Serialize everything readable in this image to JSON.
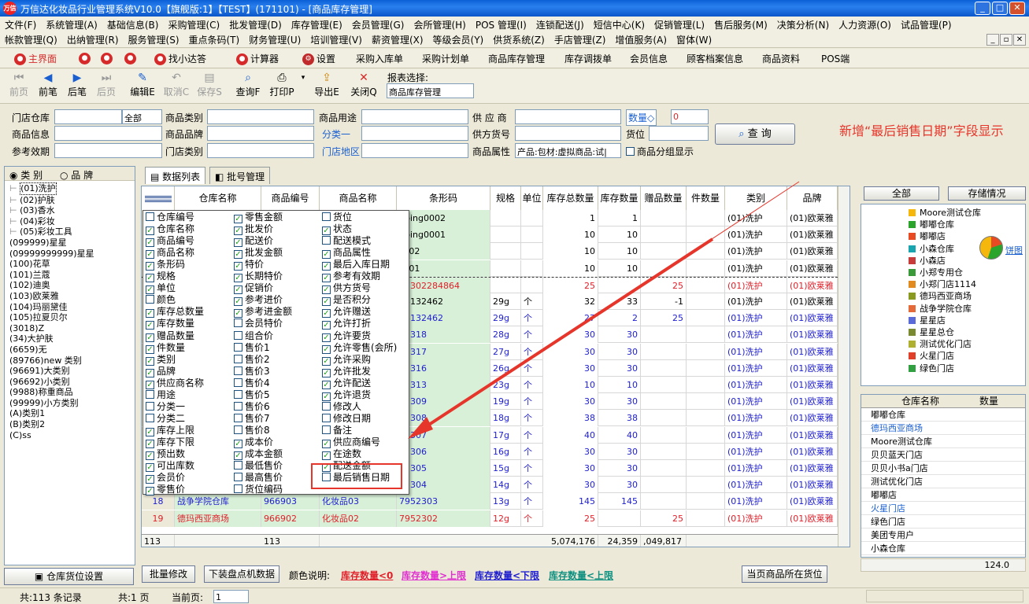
{
  "window": {
    "title": "万信达化妆品行业管理系统V10.0【旗舰版:1】【TEST】(171101) - [商品库存管理]",
    "logo_text": "万信"
  },
  "menu": {
    "row1": [
      "文件(F)",
      "系统管理(A)",
      "基础信息(B)",
      "采购管理(C)",
      "批发管理(D)",
      "库存管理(E)",
      "会员管理(G)",
      "会所管理(H)",
      "POS 管理(I)",
      "连锁配送(J)",
      "短信中心(K)",
      "促销管理(L)",
      "售后服务(M)",
      "决策分析(N)",
      "人力资源(O)",
      "试品管理(P)"
    ],
    "row2": [
      "帐款管理(Q)",
      "出纳管理(R)",
      "服务管理(S)",
      "重点条码(T)",
      "财务管理(U)",
      "培训管理(V)",
      "薪资管理(X)",
      "等级会员(Y)",
      "供货系统(Z)",
      "手店管理(Z)",
      "增值服务(A)",
      "窗体(W)"
    ]
  },
  "quickbar": [
    "主界面",
    "找小达答",
    "计算器",
    "设置",
    "采购入库单",
    "采购计划单",
    "商品库存管理",
    "库存调拨单",
    "会员信息",
    "顾客档案信息",
    "商品资料",
    "POS端"
  ],
  "toolbar": {
    "prev_first": "前页",
    "prev": "前笔",
    "next": "后笔",
    "next_last": "后页",
    "edit": "编辑E",
    "cancel": "取消C",
    "save": "保存S",
    "query": "查询F",
    "print": "打印P",
    "export": "导出E",
    "close": "关闭Q",
    "report_label": "报表选择:",
    "report_value": "商品库存管理"
  },
  "filter": {
    "store_label": "门店仓库",
    "store_all": "全部",
    "category_label": "商品类别",
    "usage_label": "商品用途",
    "supplier_label": "供 应 商",
    "qty_label": "数量◇",
    "qty_value": "0",
    "info_label": "商品信息",
    "brand_label": "商品品牌",
    "class1_label": "分类一",
    "supplier_no_label": "供方货号",
    "location_label": "货位",
    "validity_label": "参考效期",
    "store_cat_label": "门店类别",
    "region_label": "门店地区",
    "attr_label": "商品属性",
    "attr_value": "产品:包材:虚拟商品:试|",
    "group_label": "商品分组显示",
    "query_btn": "查 询"
  },
  "annotation": "新增“最后销售日期”字段显示",
  "left": {
    "radio_cat": "类 别",
    "radio_brand": "品 牌",
    "items": [
      "(01)洗护",
      "(02)护肤",
      "(03)香水",
      "(04)彩妆",
      "(05)彩妆工具",
      "(099999)星星",
      "(09999999999)星星",
      "(100)花草",
      "(101)兰蔻",
      "(102)迪奥",
      "(103)欧莱雅",
      "(104)玛丽黛佳",
      "(105)拉夏贝尔",
      "(3018)Z",
      "(34)大护肤",
      "(6659)无",
      "(89766)new 类别",
      "(96691)大类别",
      "(96692)小类别",
      "(9988)称重商品",
      "(99999)小方类别",
      "(A)类别1",
      "(B)类别2",
      "(C)ss"
    ],
    "bottom_btn": "仓库货位设置"
  },
  "tabs": [
    "数据列表",
    "批号管理"
  ],
  "grid": {
    "headers": [
      "仓库名称",
      "商品编号",
      "商品名称",
      "条形码",
      "规格",
      "单位",
      "库存总数量",
      "库存数量",
      "赠品数量",
      "件数量",
      "类别",
      "品牌"
    ],
    "rows": [
      {
        "n": "",
        "wh": "",
        "code": "",
        "name": "",
        "bar": "nping0002",
        "spec": "",
        "unit": "",
        "tot": "1",
        "qty": "1",
        "gift": "",
        "cat": "(01)洗护",
        "brand": "(01)欧莱雅",
        "color": "black"
      },
      {
        "n": "",
        "wh": "",
        "code": "",
        "name": "",
        "bar": "nping0001",
        "spec": "",
        "unit": "",
        "tot": "10",
        "qty": "10",
        "gift": "",
        "cat": "(01)洗护",
        "brand": "(01)欧莱雅",
        "color": "black"
      },
      {
        "n": "",
        "wh": "",
        "code": "",
        "name": "",
        "bar": "ck02",
        "spec": "",
        "unit": "",
        "tot": "10",
        "qty": "10",
        "gift": "",
        "cat": "(01)洗护",
        "brand": "(01)欧莱雅",
        "color": "black"
      },
      {
        "n": "",
        "wh": "",
        "code": "",
        "name": "",
        "bar": "ck01",
        "spec": "",
        "unit": "",
        "tot": "10",
        "qty": "10",
        "gift": "",
        "cat": "(01)洗护",
        "brand": "(01)欧莱雅",
        "color": "black"
      },
      {
        "n": "",
        "wh": "",
        "code": "",
        "name": "",
        "bar": "97302284864",
        "spec": "",
        "unit": "",
        "tot": "25",
        "qty": "",
        "gift": "25",
        "cat": "(01)洗护",
        "brand": "(01)欧莱雅",
        "color": "red"
      },
      {
        "n": "",
        "wh": "",
        "code": "",
        "name": "",
        "bar": "03132462",
        "spec": "29g",
        "unit": "个",
        "tot": "32",
        "qty": "33",
        "gift": "-1",
        "cat": "(01)洗护",
        "brand": "(01)欧莱雅",
        "color": "black"
      },
      {
        "n": "",
        "wh": "",
        "code": "",
        "name": "",
        "bar": "03132462",
        "spec": "29g",
        "unit": "个",
        "tot": "27",
        "qty": "2",
        "gift": "25",
        "cat": "(01)洗护",
        "brand": "(01)欧莱雅",
        "color": "blue"
      },
      {
        "n": "",
        "wh": "",
        "code": "",
        "name": "",
        "bar": "52318",
        "spec": "28g",
        "unit": "个",
        "tot": "30",
        "qty": "30",
        "gift": "",
        "cat": "(01)洗护",
        "brand": "(01)欧莱雅",
        "color": "blue"
      },
      {
        "n": "",
        "wh": "",
        "code": "",
        "name": "",
        "bar": "52317",
        "spec": "27g",
        "unit": "个",
        "tot": "30",
        "qty": "30",
        "gift": "",
        "cat": "(01)洗护",
        "brand": "(01)欧莱雅",
        "color": "blue"
      },
      {
        "n": "",
        "wh": "",
        "code": "",
        "name": "",
        "bar": "52316",
        "spec": "26g",
        "unit": "个",
        "tot": "30",
        "qty": "30",
        "gift": "",
        "cat": "(01)洗护",
        "brand": "(01)欧莱雅",
        "color": "blue"
      },
      {
        "n": "",
        "wh": "",
        "code": "",
        "name": "",
        "bar": "52313",
        "spec": "23g",
        "unit": "个",
        "tot": "10",
        "qty": "10",
        "gift": "",
        "cat": "(01)洗护",
        "brand": "(01)欧莱雅",
        "color": "blue"
      },
      {
        "n": "",
        "wh": "",
        "code": "",
        "name": "",
        "bar": "52309",
        "spec": "19g",
        "unit": "个",
        "tot": "30",
        "qty": "30",
        "gift": "",
        "cat": "(01)洗护",
        "brand": "(01)欧莱雅",
        "color": "blue"
      },
      {
        "n": "",
        "wh": "",
        "code": "",
        "name": "",
        "bar": "52308",
        "spec": "18g",
        "unit": "个",
        "tot": "38",
        "qty": "38",
        "gift": "",
        "cat": "(01)洗护",
        "brand": "(01)欧莱雅",
        "color": "blue"
      },
      {
        "n": "",
        "wh": "",
        "code": "",
        "name": "",
        "bar": "52307",
        "spec": "17g",
        "unit": "个",
        "tot": "40",
        "qty": "40",
        "gift": "",
        "cat": "(01)洗护",
        "brand": "(01)欧莱雅",
        "color": "blue"
      },
      {
        "n": "",
        "wh": "",
        "code": "",
        "name": "",
        "bar": "52306",
        "spec": "16g",
        "unit": "个",
        "tot": "30",
        "qty": "30",
        "gift": "",
        "cat": "(01)洗护",
        "brand": "(01)欧莱雅",
        "color": "blue"
      },
      {
        "n": "",
        "wh": "",
        "code": "",
        "name": "",
        "bar": "52305",
        "spec": "15g",
        "unit": "个",
        "tot": "30",
        "qty": "30",
        "gift": "",
        "cat": "(01)洗护",
        "brand": "(01)欧莱雅",
        "color": "blue"
      },
      {
        "n": "",
        "wh": "",
        "code": "",
        "name": "",
        "bar": "52304",
        "spec": "14g",
        "unit": "个",
        "tot": "30",
        "qty": "30",
        "gift": "",
        "cat": "(01)洗护",
        "brand": "(01)欧莱雅",
        "color": "blue"
      },
      {
        "n": "18",
        "wh": "战争学院仓库",
        "code": "966903",
        "name": "化妆品03",
        "bar": "7952303",
        "spec": "13g",
        "unit": "个",
        "tot": "145",
        "qty": "145",
        "gift": "",
        "cat": "(01)洗护",
        "brand": "(01)欧莱雅",
        "color": "blue"
      },
      {
        "n": "19",
        "wh": "德玛西亚商场",
        "code": "966902",
        "name": "化妆品02",
        "bar": "7952302",
        "spec": "12g",
        "unit": "个",
        "tot": "25",
        "qty": "",
        "gift": "25",
        "cat": "(01)洗护",
        "brand": "(01)欧莱雅",
        "color": "red"
      }
    ],
    "footer": {
      "count": "113",
      "code_count": "113",
      "tot": "5,074,176",
      "qty": "24,359",
      "gift": ",049,817"
    }
  },
  "popup": {
    "col1": [
      [
        "仓库编号",
        false
      ],
      [
        "仓库名称",
        true
      ],
      [
        "商品编号",
        true
      ],
      [
        "商品名称",
        true
      ],
      [
        "条形码",
        true
      ],
      [
        "规格",
        true
      ],
      [
        "单位",
        true
      ],
      [
        "颜色",
        false
      ],
      [
        "库存总数量",
        true
      ],
      [
        "库存数量",
        true
      ],
      [
        "赠品数量",
        true
      ],
      [
        "件数量",
        true
      ],
      [
        "类别",
        true
      ],
      [
        "品牌",
        true
      ],
      [
        "供应商名称",
        true
      ],
      [
        "用途",
        false
      ],
      [
        "分类一",
        false
      ],
      [
        "分类二",
        false
      ],
      [
        "库存上限",
        true
      ],
      [
        "库存下限",
        true
      ],
      [
        "预出数",
        true
      ],
      [
        "可出库数",
        true
      ],
      [
        "会员价",
        true
      ],
      [
        "零售价",
        true
      ]
    ],
    "col2": [
      [
        "零售金额",
        true
      ],
      [
        "批发价",
        true
      ],
      [
        "配送价",
        true
      ],
      [
        "批发金额",
        true
      ],
      [
        "特价",
        true
      ],
      [
        "长期特价",
        true
      ],
      [
        "促销价",
        true
      ],
      [
        "参考进价",
        true
      ],
      [
        "参考进金额",
        true
      ],
      [
        "会员特价",
        false
      ],
      [
        "组合价",
        false
      ],
      [
        "售价1",
        false
      ],
      [
        "售价2",
        false
      ],
      [
        "售价3",
        false
      ],
      [
        "售价4",
        false
      ],
      [
        "售价5",
        false
      ],
      [
        "售价6",
        false
      ],
      [
        "售价7",
        false
      ],
      [
        "售价8",
        false
      ],
      [
        "成本价",
        true
      ],
      [
        "成本金额",
        true
      ],
      [
        "最低售价",
        false
      ],
      [
        "最高售价",
        false
      ],
      [
        "货位编码",
        false
      ]
    ],
    "col3": [
      [
        "货位",
        false
      ],
      [
        "状态",
        true
      ],
      [
        "配送模式",
        false
      ],
      [
        "商品属性",
        true
      ],
      [
        "最后入库日期",
        true
      ],
      [
        "参考有效期",
        true
      ],
      [
        "供方货号",
        true
      ],
      [
        "是否积分",
        true
      ],
      [
        "允许赠送",
        true
      ],
      [
        "允许打折",
        true
      ],
      [
        "允许要货",
        true
      ],
      [
        "允许零售(会所)",
        true
      ],
      [
        "允许采购",
        true
      ],
      [
        "允许批发",
        true
      ],
      [
        "允许配送",
        true
      ],
      [
        "允许退货",
        true
      ],
      [
        "修改人",
        false
      ],
      [
        "修改日期",
        false
      ],
      [
        "备注",
        false
      ],
      [
        "供应商编号",
        true
      ],
      [
        "在途数",
        true
      ],
      [
        "配送金额",
        true
      ],
      [
        "最后销售日期",
        false
      ]
    ]
  },
  "right": {
    "btn_all": "全部",
    "btn_storage": "存储情况",
    "pie_label": "饼图",
    "legend": [
      [
        "Moore测试仓库",
        "#f5b70c"
      ],
      [
        "嘟嘟仓库",
        "#2ba42b"
      ],
      [
        "嘟嘟店",
        "#e84a23"
      ],
      [
        "小森仓库",
        "#18a5b0"
      ],
      [
        "小森店",
        "#c93a3a"
      ],
      [
        "小郑专用仓",
        "#3a9a3a"
      ],
      [
        "小郑门店1114",
        "#e08a20"
      ],
      [
        "德玛西亚商场",
        "#8a9a20"
      ],
      [
        "战争学院仓库",
        "#e56a3a"
      ],
      [
        "星星店",
        "#5a6ad8"
      ],
      [
        "星星总仓",
        "#7a8a30"
      ],
      [
        "测试优化门店",
        "#b0b030"
      ],
      [
        "火星门店",
        "#e0402a"
      ],
      [
        "绿色门店",
        "#30a040"
      ]
    ],
    "table_head": [
      "仓库名称",
      "数量"
    ],
    "table_rows": [
      "嘟嘟仓库",
      "德玛西亚商场",
      "Moore测试仓库",
      "贝贝蓝天门店",
      "贝贝小书a门店",
      "测试优化门店",
      "嘟嘟店",
      "火星门店",
      "绿色门店",
      "美团专用户",
      "小森仓库"
    ],
    "table_value": "124.0"
  },
  "bottom": {
    "batch_edit": "批量修改",
    "download": "下装盘点机数据",
    "color_label": "颜色说明:",
    "c1": "库存数量<0",
    "c2": "库存数量>上限",
    "c3": "库存数量<下限",
    "c4": "库存数量<上限",
    "cur_loc": "当页商品所在货位"
  },
  "status": {
    "records": "共:113 条记录",
    "pages": "共:1 页",
    "cur_page_label": "当前页:",
    "cur_page": "1"
  }
}
